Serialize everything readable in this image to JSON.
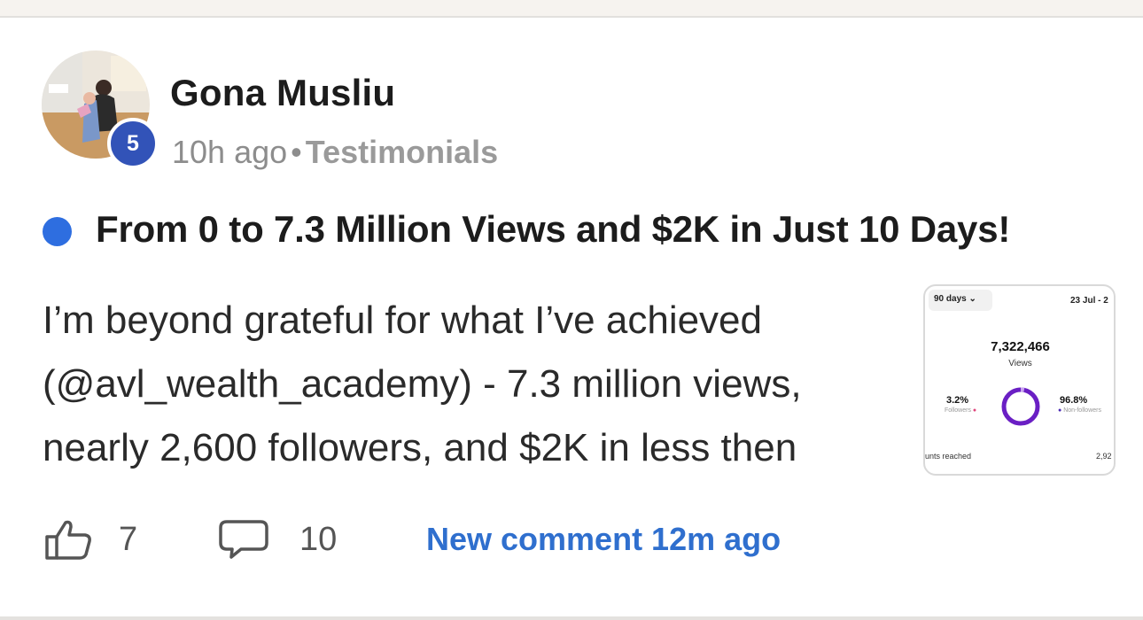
{
  "post": {
    "author": "Gona Musliu",
    "level": "5",
    "time": "10h ago",
    "separator": "•",
    "category": "Testimonials",
    "title": "From 0 to 7.3 Million Views and $2K in Just 10 Days!",
    "body_lines": [
      "I’m beyond grateful for what I’ve achieved",
      "(@avl_wealth_academy) - 7.3 million views,",
      "nearly 2,600 followers, and $2K in less then"
    ]
  },
  "thumbnail": {
    "range": "90 days",
    "date": "23 Jul - 2",
    "total": "7,322,466",
    "total_label": "Views",
    "left_pct": "3.2%",
    "left_label": "Followers",
    "right_pct": "96.8%",
    "right_label": "Non-followers",
    "foot_left": "unts reached",
    "foot_right": "2,92",
    "followers_share": 0.032,
    "colors": {
      "ring": "#6a1fc4",
      "ring_light": "#c9a3f0",
      "dot_left": "#e0467c",
      "dot_right": "#4b2ab5"
    }
  },
  "actions": {
    "likes": "7",
    "comments": "10",
    "new_comment": "New comment 12m ago"
  },
  "colors": {
    "accent": "#2f6fce",
    "unread": "#2e6ee0",
    "badge": "#3253b8"
  }
}
